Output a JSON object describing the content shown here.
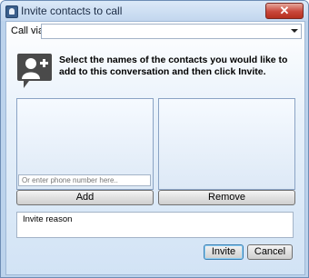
{
  "window": {
    "title": "Invite contacts to call"
  },
  "call_via": {
    "label": "Call via:",
    "value": ""
  },
  "instruction": "Select the names of the contacts you would like to add to this conversation and then click Invite.",
  "left_list": {
    "items": []
  },
  "right_list": {
    "items": []
  },
  "phone_input": {
    "placeholder": "Or enter phone number here.."
  },
  "buttons": {
    "add": "Add",
    "remove": "Remove",
    "invite": "Invite",
    "cancel": "Cancel"
  },
  "reason": {
    "placeholder": "Invite reason"
  },
  "icons": {
    "app": "phone-app-icon",
    "close": "close-icon",
    "contact": "add-contact-icon",
    "dropdown": "chevron-down-icon"
  }
}
